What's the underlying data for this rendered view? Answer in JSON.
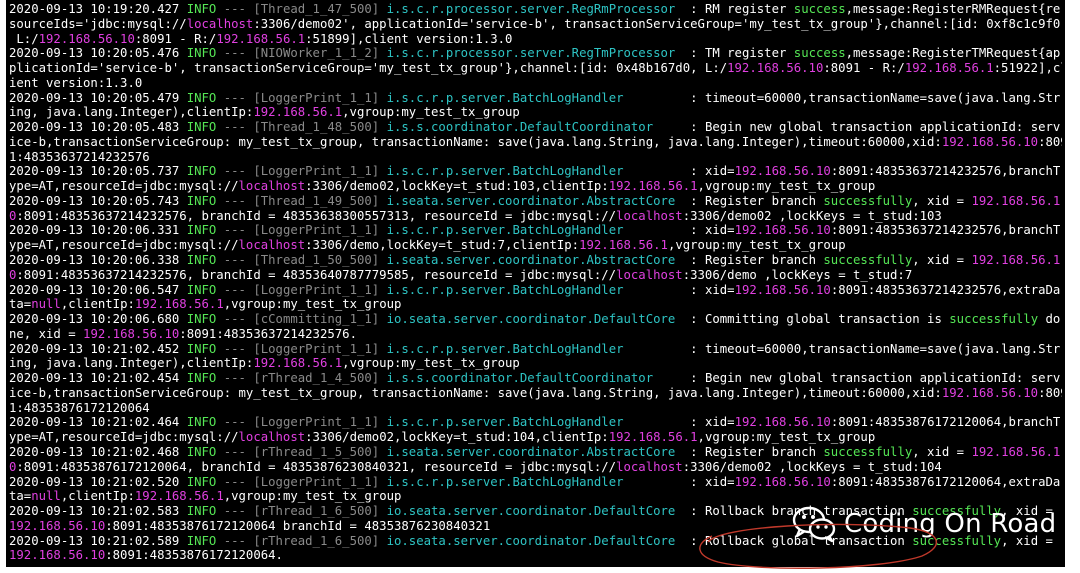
{
  "log_lines": [
    [
      [
        "ts",
        "2020-09-13 10:19:20.427 "
      ],
      [
        "lvl",
        "INFO"
      ],
      [
        "thr",
        " --- [Thread_1_47_500] "
      ],
      [
        "cls",
        "i.s.c.r.processor.server.RegRmProcessor"
      ],
      [
        "txt",
        "  : RM register "
      ],
      [
        "ok",
        "success"
      ],
      [
        "txt",
        ",message:RegisterRMRequest{re"
      ]
    ],
    [
      [
        "txt",
        "sourceIds='jdbc:mysql://"
      ],
      [
        "mg",
        "localhost"
      ],
      [
        "txt",
        ":3306/demo02', applicationId='service-b', transactionServiceGroup='my_test_tx_group'},channel:[id: 0xf8c1c9f0,"
      ]
    ],
    [
      [
        "txt",
        " L:/"
      ],
      [
        "mg",
        "192.168.56.10"
      ],
      [
        "txt",
        ":8091 - R:/"
      ],
      [
        "mg",
        "192.168.56.1"
      ],
      [
        "txt",
        ":51899],client version:1.3.0"
      ]
    ],
    [
      [
        "ts",
        "2020-09-13 10:20:05.476 "
      ],
      [
        "lvl",
        "INFO"
      ],
      [
        "thr",
        " --- [NIOWorker_1_1_2] "
      ],
      [
        "cls",
        "i.s.c.r.processor.server.RegTmProcessor"
      ],
      [
        "txt",
        "  : TM register "
      ],
      [
        "ok",
        "success"
      ],
      [
        "txt",
        ",message:RegisterTMRequest{ap"
      ]
    ],
    [
      [
        "txt",
        "plicationId='service-b', transactionServiceGroup='my_test_tx_group'},channel:[id: 0x48b167d0, L:/"
      ],
      [
        "mg",
        "192.168.56.10"
      ],
      [
        "txt",
        ":8091 - R:/"
      ],
      [
        "mg",
        "192.168.56.1"
      ],
      [
        "txt",
        ":51922],cl"
      ]
    ],
    [
      [
        "txt",
        "ient version:1.3.0"
      ]
    ],
    [
      [
        "ts",
        "2020-09-13 10:20:05.479 "
      ],
      [
        "lvl",
        "INFO"
      ],
      [
        "thr",
        " --- [LoggerPrint_1_1] "
      ],
      [
        "cls",
        "i.s.c.r.p.server.BatchLogHandler"
      ],
      [
        "txt",
        "         : timeout=60000,transactionName=save(java.lang.Str"
      ]
    ],
    [
      [
        "txt",
        "ing, java.lang.Integer),clientIp:"
      ],
      [
        "mg",
        "192.168.56.1"
      ],
      [
        "txt",
        ",vgroup:my_test_tx_group"
      ]
    ],
    [
      [
        "ts",
        "2020-09-13 10:20:05.483 "
      ],
      [
        "lvl",
        "INFO"
      ],
      [
        "thr",
        " --- [Thread_1_48_500] "
      ],
      [
        "cls",
        "i.s.s.coordinator.DefaultCoordinator"
      ],
      [
        "txt",
        "     : Begin new global transaction applicationId: serv"
      ]
    ],
    [
      [
        "txt",
        "ice-b,transactionServiceGroup: my_test_tx_group, transactionName: save(java.lang.String, java.lang.Integer),timeout:60000,xid:"
      ],
      [
        "mg",
        "192.168.56.10"
      ],
      [
        "txt",
        ":809"
      ]
    ],
    [
      [
        "txt",
        "1:48353637214232576"
      ]
    ],
    [
      [
        "ts",
        "2020-09-13 10:20:05.737 "
      ],
      [
        "lvl",
        "INFO"
      ],
      [
        "thr",
        " --- [LoggerPrint_1_1] "
      ],
      [
        "cls",
        "i.s.c.r.p.server.BatchLogHandler"
      ],
      [
        "txt",
        "         : xid="
      ],
      [
        "mg",
        "192.168.56.10"
      ],
      [
        "txt",
        ":8091:48353637214232576,branchT"
      ]
    ],
    [
      [
        "txt",
        "ype=AT,resourceId=jdbc:mysql://"
      ],
      [
        "mg",
        "localhost"
      ],
      [
        "txt",
        ":3306/demo02,lockKey=t_stud:103,clientIp:"
      ],
      [
        "mg",
        "192.168.56.1"
      ],
      [
        "txt",
        ",vgroup:my_test_tx_group"
      ]
    ],
    [
      [
        "ts",
        "2020-09-13 10:20:05.743 "
      ],
      [
        "lvl",
        "INFO"
      ],
      [
        "thr",
        " --- [Thread_1_49_500] "
      ],
      [
        "cls",
        "i.seata.server.coordinator.AbstractCore"
      ],
      [
        "txt",
        "  : Register branch "
      ],
      [
        "ok",
        "successfully"
      ],
      [
        "txt",
        ", xid = "
      ],
      [
        "mg",
        "192.168.56.1"
      ]
    ],
    [
      [
        "mg",
        "0"
      ],
      [
        "txt",
        ":8091:48353637214232576, branchId = 48353638300557313, resourceId = jdbc:mysql://"
      ],
      [
        "mg",
        "localhost"
      ],
      [
        "txt",
        ":3306/demo02 ,lockKeys = t_stud:103"
      ]
    ],
    [
      [
        "ts",
        "2020-09-13 10:20:06.331 "
      ],
      [
        "lvl",
        "INFO"
      ],
      [
        "thr",
        " --- [LoggerPrint_1_1] "
      ],
      [
        "cls",
        "i.s.c.r.p.server.BatchLogHandler"
      ],
      [
        "txt",
        "         : xid="
      ],
      [
        "mg",
        "192.168.56.10"
      ],
      [
        "txt",
        ":8091:48353637214232576,branchT"
      ]
    ],
    [
      [
        "txt",
        "ype=AT,resourceId=jdbc:mysql://"
      ],
      [
        "mg",
        "localhost"
      ],
      [
        "txt",
        ":3306/demo,lockKey=t_stud:7,clientIp:"
      ],
      [
        "mg",
        "192.168.56.1"
      ],
      [
        "txt",
        ",vgroup:my_test_tx_group"
      ]
    ],
    [
      [
        "ts",
        "2020-09-13 10:20:06.338 "
      ],
      [
        "lvl",
        "INFO"
      ],
      [
        "thr",
        " --- [Thread_1_50_500] "
      ],
      [
        "cls",
        "i.seata.server.coordinator.AbstractCore"
      ],
      [
        "txt",
        "  : Register branch "
      ],
      [
        "ok",
        "successfully"
      ],
      [
        "txt",
        ", xid = "
      ],
      [
        "mg",
        "192.168.56.1"
      ]
    ],
    [
      [
        "mg",
        "0"
      ],
      [
        "txt",
        ":8091:48353637214232576, branchId = 48353640787779585, resourceId = jdbc:mysql://"
      ],
      [
        "mg",
        "localhost"
      ],
      [
        "txt",
        ":3306/demo ,lockKeys = t_stud:7"
      ]
    ],
    [
      [
        "ts",
        "2020-09-13 10:20:06.547 "
      ],
      [
        "lvl",
        "INFO"
      ],
      [
        "thr",
        " --- [LoggerPrint_1_1] "
      ],
      [
        "cls",
        "i.s.c.r.p.server.BatchLogHandler"
      ],
      [
        "txt",
        "         : xid="
      ],
      [
        "mg",
        "192.168.56.10"
      ],
      [
        "txt",
        ":8091:48353637214232576,extraDa"
      ]
    ],
    [
      [
        "txt",
        "ta="
      ],
      [
        "mg",
        "null"
      ],
      [
        "txt",
        ",clientIp:"
      ],
      [
        "mg",
        "192.168.56.1"
      ],
      [
        "txt",
        ",vgroup:my_test_tx_group"
      ]
    ],
    [
      [
        "ts",
        "2020-09-13 10:20:06.680 "
      ],
      [
        "lvl",
        "INFO"
      ],
      [
        "thr",
        " --- [cCommitting_1_1] "
      ],
      [
        "cls",
        "io.seata.server.coordinator.DefaultCore"
      ],
      [
        "txt",
        "  : Committing global transaction is "
      ],
      [
        "ok",
        "successfully"
      ],
      [
        "txt",
        " do"
      ]
    ],
    [
      [
        "txt",
        "ne, xid = "
      ],
      [
        "mg",
        "192.168.56.10"
      ],
      [
        "txt",
        ":8091:48353637214232576."
      ]
    ],
    [
      [
        "ts",
        "2020-09-13 10:21:02.452 "
      ],
      [
        "lvl",
        "INFO"
      ],
      [
        "thr",
        " --- [LoggerPrint_1_1] "
      ],
      [
        "cls",
        "i.s.c.r.p.server.BatchLogHandler"
      ],
      [
        "txt",
        "         : timeout=60000,transactionName=save(java.lang.Str"
      ]
    ],
    [
      [
        "txt",
        "ing, java.lang.Integer),clientIp:"
      ],
      [
        "mg",
        "192.168.56.1"
      ],
      [
        "txt",
        ",vgroup:my_test_tx_group"
      ]
    ],
    [
      [
        "ts",
        "2020-09-13 10:21:02.454 "
      ],
      [
        "lvl",
        "INFO"
      ],
      [
        "thr",
        " --- [rThread_1_4_500] "
      ],
      [
        "cls",
        "i.s.s.coordinator.DefaultCoordinator"
      ],
      [
        "txt",
        "     : Begin new global transaction applicationId: serv"
      ]
    ],
    [
      [
        "txt",
        "ice-b,transactionServiceGroup: my_test_tx_group, transactionName: save(java.lang.String, java.lang.Integer),timeout:60000,xid:"
      ],
      [
        "mg",
        "192.168.56.10"
      ],
      [
        "txt",
        ":809"
      ]
    ],
    [
      [
        "txt",
        "1:48353876172120064"
      ]
    ],
    [
      [
        "ts",
        "2020-09-13 10:21:02.464 "
      ],
      [
        "lvl",
        "INFO"
      ],
      [
        "thr",
        " --- [LoggerPrint_1_1] "
      ],
      [
        "cls",
        "i.s.c.r.p.server.BatchLogHandler"
      ],
      [
        "txt",
        "         : xid="
      ],
      [
        "mg",
        "192.168.56.10"
      ],
      [
        "txt",
        ":8091:48353876172120064,branchT"
      ]
    ],
    [
      [
        "txt",
        "ype=AT,resourceId=jdbc:mysql://"
      ],
      [
        "mg",
        "localhost"
      ],
      [
        "txt",
        ":3306/demo02,lockKey=t_stud:104,clientIp:"
      ],
      [
        "mg",
        "192.168.56.1"
      ],
      [
        "txt",
        ",vgroup:my_test_tx_group"
      ]
    ],
    [
      [
        "ts",
        "2020-09-13 10:21:02.468 "
      ],
      [
        "lvl",
        "INFO"
      ],
      [
        "thr",
        " --- [rThread_1_5_500] "
      ],
      [
        "cls",
        "i.seata.server.coordinator.AbstractCore"
      ],
      [
        "txt",
        "  : Register branch "
      ],
      [
        "ok",
        "successfully"
      ],
      [
        "txt",
        ", xid = "
      ],
      [
        "mg",
        "192.168.56.1"
      ]
    ],
    [
      [
        "mg",
        "0"
      ],
      [
        "txt",
        ":8091:48353876172120064, branchId = 48353876230840321, resourceId = jdbc:mysql://"
      ],
      [
        "mg",
        "localhost"
      ],
      [
        "txt",
        ":3306/demo02 ,lockKeys = t_stud:104"
      ]
    ],
    [
      [
        "ts",
        "2020-09-13 10:21:02.520 "
      ],
      [
        "lvl",
        "INFO"
      ],
      [
        "thr",
        " --- [LoggerPrint_1_1] "
      ],
      [
        "cls",
        "i.s.c.r.p.server.BatchLogHandler"
      ],
      [
        "txt",
        "         : xid="
      ],
      [
        "mg",
        "192.168.56.10"
      ],
      [
        "txt",
        ":8091:48353876172120064,extraDa"
      ]
    ],
    [
      [
        "txt",
        "ta="
      ],
      [
        "mg",
        "null"
      ],
      [
        "txt",
        ",clientIp:"
      ],
      [
        "mg",
        "192.168.56.1"
      ],
      [
        "txt",
        ",vgroup:my_test_tx_group"
      ]
    ],
    [
      [
        "ts",
        "2020-09-13 10:21:02.583 "
      ],
      [
        "lvl",
        "INFO"
      ],
      [
        "thr",
        " --- [rThread_1_6_500] "
      ],
      [
        "cls",
        "io.seata.server.coordinator.DefaultCore"
      ],
      [
        "txt",
        "  : Rollback branch transaction "
      ],
      [
        "ok",
        "successfully"
      ],
      [
        "txt",
        ", xid ="
      ]
    ],
    [
      [
        "mg",
        "192.168.56.10"
      ],
      [
        "txt",
        ":8091:48353876172120064 branchId = 48353876230840321"
      ]
    ],
    [
      [
        "ts",
        "2020-09-13 10:21:02.589 "
      ],
      [
        "lvl",
        "INFO"
      ],
      [
        "thr",
        " --- [rThread_1_6_500] "
      ],
      [
        "cls",
        "io.seata.server.coordinator.DefaultCore"
      ],
      [
        "txt",
        "  : Rollback global transaction "
      ],
      [
        "ok",
        "successfully"
      ],
      [
        "txt",
        ", xid ="
      ]
    ],
    [
      [
        "mg",
        "192.168.56.10"
      ],
      [
        "txt",
        ":8091:48353876172120064."
      ]
    ]
  ],
  "watermark": {
    "text": "Coding On Road",
    "icon": "wechat-icon"
  },
  "colors": {
    "background": "#000000",
    "text": "#ffffff",
    "level": "#55e655",
    "thread": "#8a8a8a",
    "logger_class": "#2ec4c4",
    "highlight": "#e040e0",
    "success": "#55e655",
    "annotation": "#c0392b"
  }
}
